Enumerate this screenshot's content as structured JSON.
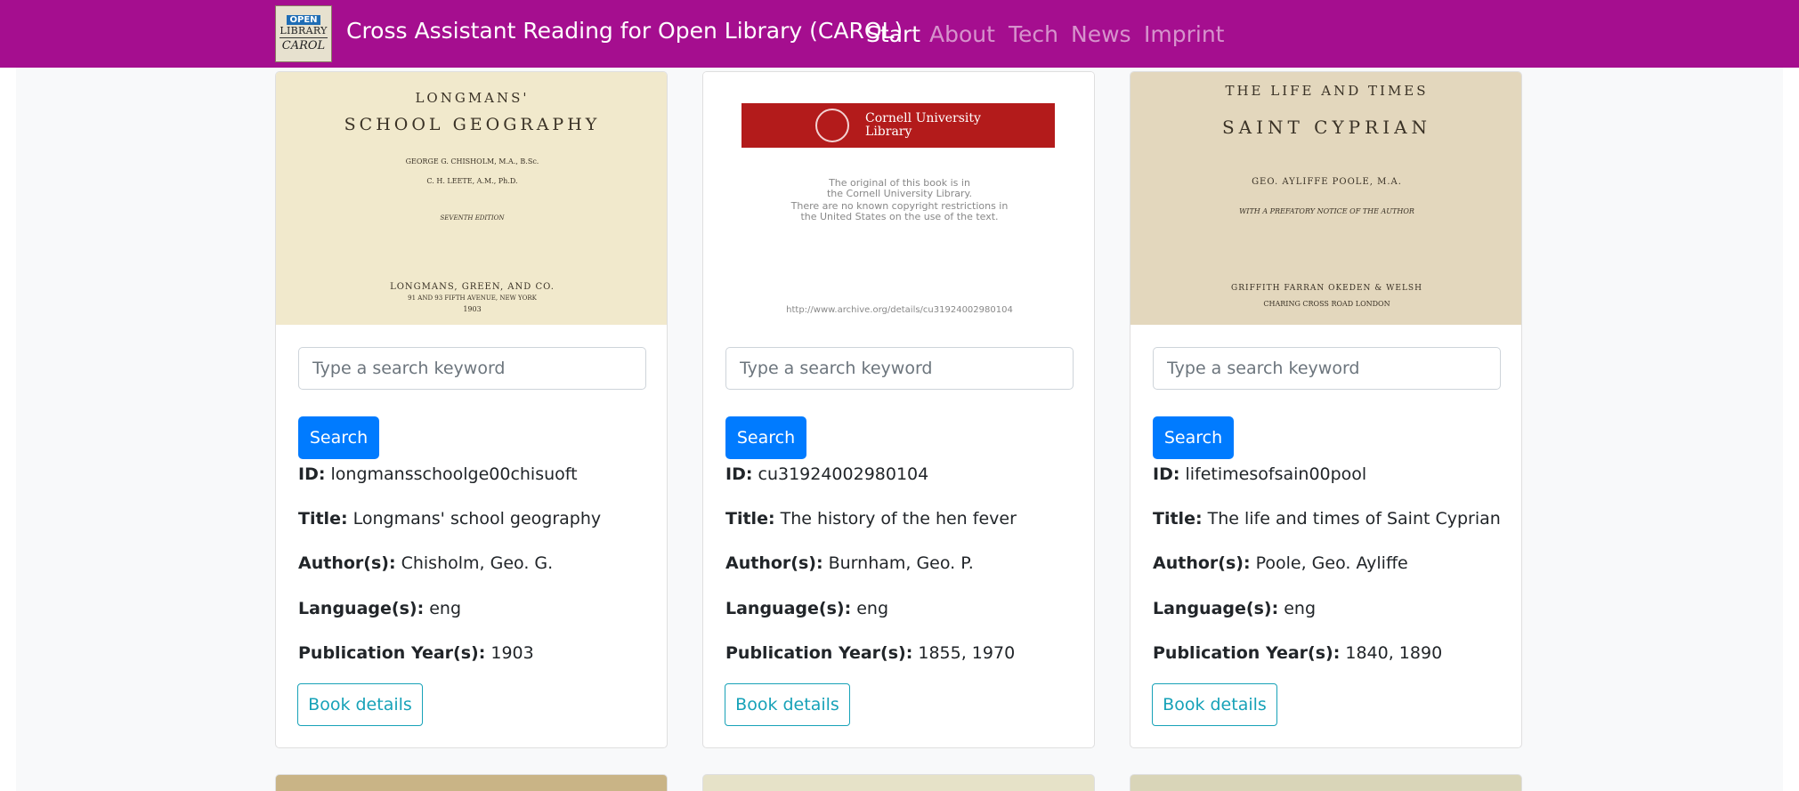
{
  "navbar": {
    "logo": {
      "open": "OPEN",
      "library": "LIBRARY",
      "carol": "CAROL"
    },
    "title": "Cross Assistant Reading for Open Library (CAROL)",
    "items": [
      {
        "label": "Start",
        "active": true
      },
      {
        "label": "About",
        "active": false
      },
      {
        "label": "Tech",
        "active": false
      },
      {
        "label": "News",
        "active": false
      },
      {
        "label": "Imprint",
        "active": false
      }
    ]
  },
  "search": {
    "placeholder": "Type a search keyword",
    "button_label": "Search"
  },
  "field_labels": {
    "id": "ID:",
    "title": "Title:",
    "authors": "Author(s):",
    "languages": "Language(s):",
    "years": "Publication Year(s):"
  },
  "details_label": "Book details",
  "books": [
    {
      "id": "longmansschoolge00chisuoft",
      "title": "Longmans' school geography",
      "authors": "Chisholm, Geo. G.",
      "languages": "eng",
      "years": "1903",
      "cover": {
        "line1": "LONGMANS'",
        "line2": "SCHOOL GEOGRAPHY",
        "line3": "GEORGE G. CHISHOLM, M.A., B.Sc.",
        "line4": "C. H. LEETE, A.M., Ph.D.",
        "line5": "SEVENTH EDITION",
        "line6": "LONGMANS, GREEN, AND CO.",
        "line7": "91 AND 93 FIFTH AVENUE, NEW YORK",
        "line8": "1903"
      }
    },
    {
      "id": "cu31924002980104",
      "title": "The history of the hen fever",
      "authors": "Burnham, Geo. P.",
      "languages": "eng",
      "years": "1855, 1970",
      "cover": {
        "lib1": "Cornell University",
        "lib2": "Library",
        "note1": "The original of this book is in",
        "note2": "the Cornell University Library.",
        "note3": "There are no known copyright restrictions in",
        "note4": "the United States on the use of the text.",
        "url": "http://www.archive.org/details/cu31924002980104"
      }
    },
    {
      "id": "lifetimesofsain00pool",
      "title": "The life and times of Saint Cyprian",
      "authors": "Poole, Geo. Ayliffe",
      "languages": "eng",
      "years": "1840, 1890",
      "cover": {
        "line1": "THE LIFE AND TIMES",
        "line2": "SAINT CYPRIAN",
        "line3": "GEO. AYLIFFE POOLE, M.A.",
        "line4": "WITH A PREFATORY NOTICE OF THE AUTHOR",
        "line5": "GRIFFITH FARRAN OKEDEN & WELSH",
        "line6": "CHARING CROSS ROAD LONDON"
      }
    }
  ],
  "colors": {
    "navbar": "#a50e8f",
    "primary": "#007bff",
    "info": "#17a2b8",
    "cornell_red": "#b31b1b"
  }
}
